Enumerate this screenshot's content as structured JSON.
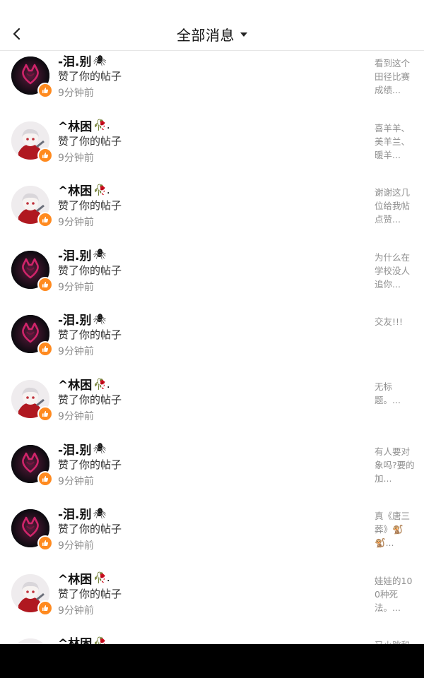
{
  "header": {
    "title": "全部消息"
  },
  "rows": [
    {
      "name": "-泪.别",
      "emoji": "🕷",
      "avatar": "dark",
      "action": "赞了你的帖子",
      "time": "9分钟前",
      "preview": "看到这个田径比赛成绩..."
    },
    {
      "name": "^林困",
      "emoji": "🥀.",
      "avatar": "light",
      "action": "赞了你的帖子",
      "time": "9分钟前",
      "preview": "喜羊羊、美羊兰、暖羊..."
    },
    {
      "name": "^林困",
      "emoji": "🥀.",
      "avatar": "light",
      "action": "赞了你的帖子",
      "time": "9分钟前",
      "preview": "谢谢这几位给我帖点赞..."
    },
    {
      "name": "-泪.别",
      "emoji": "🕷",
      "avatar": "dark",
      "action": "赞了你的帖子",
      "time": "9分钟前",
      "preview": "为什么在学校没人追你..."
    },
    {
      "name": "-泪.别",
      "emoji": "🕷",
      "avatar": "dark",
      "action": "赞了你的帖子",
      "time": "9分钟前",
      "preview": "交友!!!"
    },
    {
      "name": "^林困",
      "emoji": "🥀.",
      "avatar": "light",
      "action": "赞了你的帖子",
      "time": "9分钟前",
      "preview": "无标题。..."
    },
    {
      "name": "-泪.别",
      "emoji": "🕷",
      "avatar": "dark",
      "action": "赞了你的帖子",
      "time": "9分钟前",
      "preview": "有人要对象吗?要的加..."
    },
    {
      "name": "-泪.别",
      "emoji": "🕷",
      "avatar": "dark",
      "action": "赞了你的帖子",
      "time": "9分钟前",
      "preview": "真《唐三葬》🐒🐒..."
    },
    {
      "name": "^林困",
      "emoji": "🥀.",
      "avatar": "light",
      "action": "赞了你的帖子",
      "time": "9分钟前",
      "preview": "娃娃的100种死法。..."
    },
    {
      "name": "^林困",
      "emoji": "🥀.",
      "avatar": "light",
      "action": "",
      "time": "",
      "preview": "又小跳和"
    }
  ]
}
